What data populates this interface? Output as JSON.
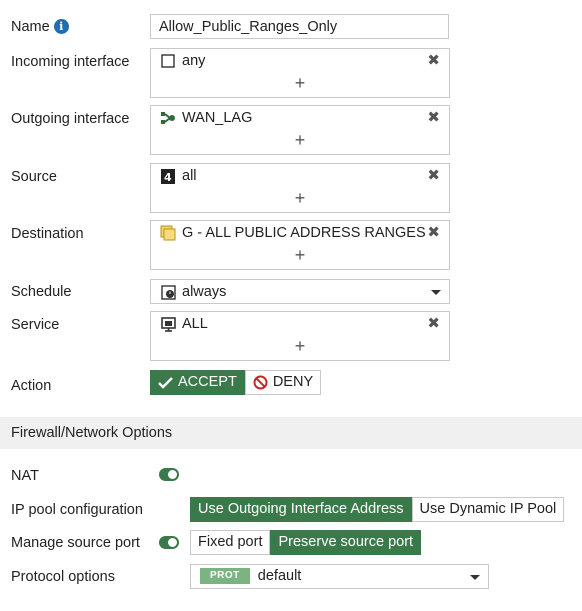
{
  "name": {
    "label": "Name",
    "value": "Allow_Public_Ranges_Only"
  },
  "incoming": {
    "label": "Incoming interface",
    "value": "any"
  },
  "outgoing": {
    "label": "Outgoing interface",
    "value": "WAN_LAG"
  },
  "source": {
    "label": "Source",
    "value": "all"
  },
  "destination": {
    "label": "Destination",
    "value": "G - ALL PUBLIC ADDRESS RANGES"
  },
  "schedule": {
    "label": "Schedule",
    "value": "always"
  },
  "service": {
    "label": "Service",
    "value": "ALL"
  },
  "action": {
    "label": "Action",
    "accept": "ACCEPT",
    "deny": "DENY"
  },
  "section_title": "Firewall/Network Options",
  "nat": {
    "label": "NAT",
    "enabled": true
  },
  "ip_pool": {
    "label": "IP pool configuration",
    "options": [
      "Use Outgoing Interface Address",
      "Use Dynamic IP Pool"
    ],
    "selected": 0
  },
  "source_port": {
    "label": "Manage source port",
    "enabled": true,
    "options": [
      "Fixed port",
      "Preserve source port"
    ],
    "selected": 1
  },
  "protocol": {
    "label": "Protocol options",
    "badge": "PROT",
    "value": "default"
  },
  "glyphs": {
    "info": "i",
    "remove": "✖",
    "add": "+"
  },
  "colors": {
    "accent": "#3a7a4a",
    "info": "#1f6fb0",
    "deny": "#c62828"
  }
}
